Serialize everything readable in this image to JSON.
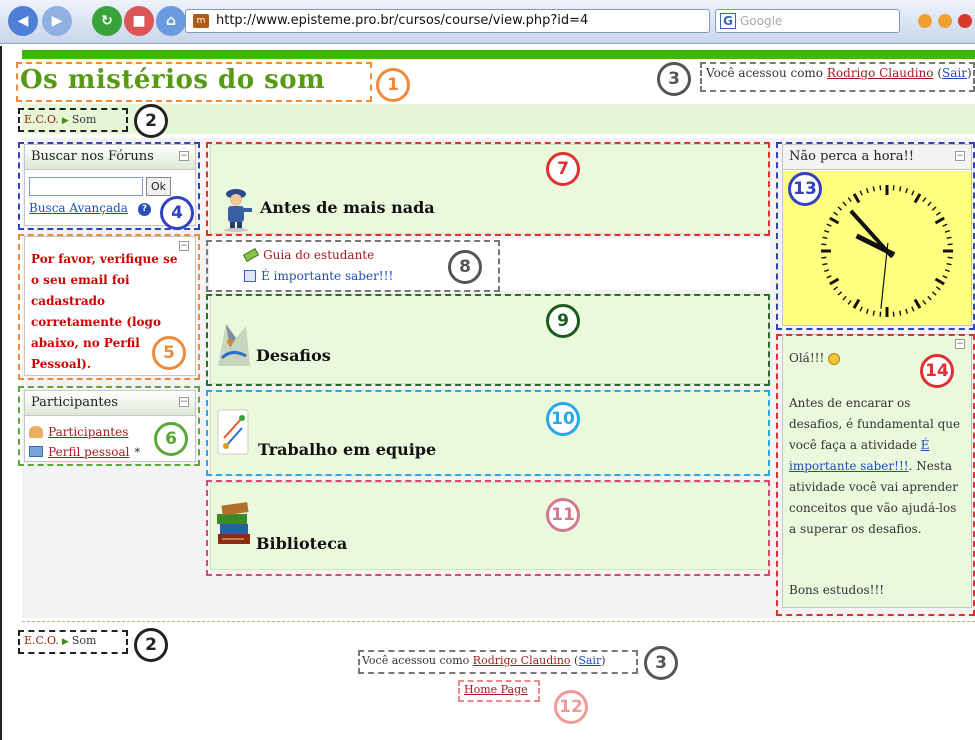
{
  "browser": {
    "url": "http://www.episteme.pro.br/cursos/course/view.php?id=4",
    "search_placeholder": "Google"
  },
  "site": {
    "title": "Os mistérios do som"
  },
  "login": {
    "prefix": "Você acessou como",
    "user": "Rodrigo Claudino",
    "logout": "Sair"
  },
  "breadcrumb": {
    "home": "E.C.O.",
    "current": "Som"
  },
  "forum_search": {
    "title": "Buscar nos Fóruns",
    "input_value": "",
    "ok_label": "Ok",
    "advanced_link": "Busca Avançada"
  },
  "notice": {
    "text": "Por favor, verifique se o seu email foi cadastrado corretamente (logo abaixo, no Perfil Pessoal)."
  },
  "participants": {
    "title": "Participantes",
    "items": [
      "Participantes",
      "Perfil pessoal"
    ]
  },
  "sections": {
    "intro_title": "Antes de mais nada",
    "links": [
      "Guia do estudante",
      "É importante saber!!!"
    ],
    "challenges_title": "Desafios",
    "teamwork_title": "Trabalho em equipe",
    "library_title": "Biblioteca"
  },
  "clock_block": {
    "title": "Não perca a hora!!",
    "time_hour": 9,
    "time_minute": 53,
    "time_second": 31
  },
  "message_block": {
    "greeting": "Olá!!!",
    "text1": "Antes de encarar os desafios, é fundamental que você faça a atividade",
    "link": "É importante saber!!!",
    "text2": ". Nesta atividade você vai aprender conceitos que vão ajudá-los a superar os desafios.",
    "closing": "Bons estudos!!!"
  },
  "footer": {
    "home_link": "Home Page"
  },
  "annotations": [
    "1",
    "2",
    "3",
    "4",
    "5",
    "6",
    "7",
    "8",
    "9",
    "10",
    "11",
    "12",
    "13",
    "14"
  ],
  "colors": {
    "accent_green": "#3cb805",
    "title_green": "#569a15",
    "section_bg": "#eaf8dc",
    "link_red": "#a11c1c",
    "notice_red": "#cc0000",
    "clock_bg": "#ffff80"
  }
}
